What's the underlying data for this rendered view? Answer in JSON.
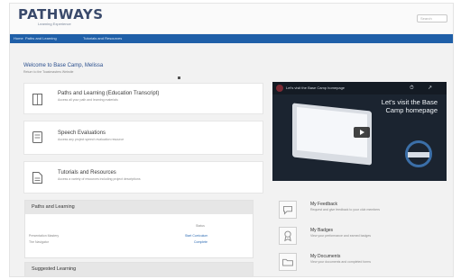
{
  "header": {
    "logo": "PATHWAYS",
    "logo_tagline": "Learning Experience",
    "search_placeholder": "Search"
  },
  "nav": {
    "items": [
      "Home",
      "Paths and Learning",
      "Tutorials and Resources"
    ]
  },
  "welcome": {
    "title": "Welcome to Base Camp, Melissa",
    "subtitle": "Return to the Toastmasters Website"
  },
  "cards": [
    {
      "icon": "book-icon",
      "title": "Paths and Learning (Education Transcript)",
      "desc": "Access all your path and learning materials"
    },
    {
      "icon": "speech-evaluation-icon",
      "title": "Speech Evaluations",
      "desc": "Access any project speech evaluation resource"
    },
    {
      "icon": "document-icon",
      "title": "Tutorials and Resources",
      "desc": "Access a variety of resources including project descriptions"
    }
  ],
  "video": {
    "title": "Let's visit the Base Camp homepage",
    "headline_line1": "Let's visit the Base",
    "headline_line2": "Camp homepage",
    "watch_later": "⏱",
    "share": "↗"
  },
  "paths_panel": {
    "heading": "Paths and Learning",
    "column": "Status",
    "rows": [
      {
        "name": "Presentation Mastery",
        "status": "Start Curriculum"
      },
      {
        "name": "The Navigator",
        "status": "Complete"
      }
    ]
  },
  "suggested_panel": {
    "heading": "Suggested Learning"
  },
  "tiles": [
    {
      "icon": "feedback-icon",
      "title": "My Feedback",
      "desc": "Request and give feedback to your club members"
    },
    {
      "icon": "badge-icon",
      "title": "My Badges",
      "desc": "View your performance and earned badges"
    },
    {
      "icon": "folder-icon",
      "title": "My Documents",
      "desc": "View your documents and completed forms"
    }
  ]
}
